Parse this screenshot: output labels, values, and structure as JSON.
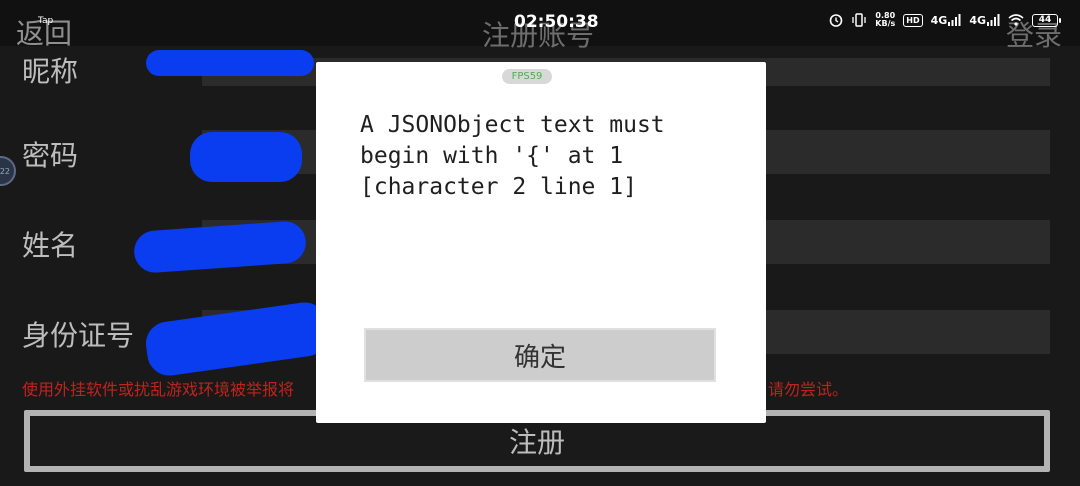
{
  "status_bar": {
    "tap": "Tap",
    "time": "02:50:38",
    "net_speed_value": "0.80",
    "net_speed_unit": "KB/s",
    "hd": "HD",
    "sim1": "4G",
    "sim2": "4G",
    "battery": "44"
  },
  "nav": {
    "back": "返回",
    "title": "注册账号",
    "login": "登录"
  },
  "form": {
    "nickname_label": "昵称",
    "password_label": "密码",
    "name_label": "姓名",
    "id_label": "身份证号"
  },
  "side_dot": "22",
  "warning": {
    "lead": "使用外挂软件或扰乱游戏环境被举报将",
    "tail": "请勿尝试。"
  },
  "register_button": "注册",
  "dialog": {
    "fps": "FPS59",
    "message": "A JSONObject text must\nbegin with '{' at 1\n[character 2 line 1]",
    "confirm": "确定"
  },
  "colors": {
    "background": "#191919",
    "warning": "#c0231c",
    "redaction": "#0a3cf0",
    "fps": "#4caf50"
  }
}
